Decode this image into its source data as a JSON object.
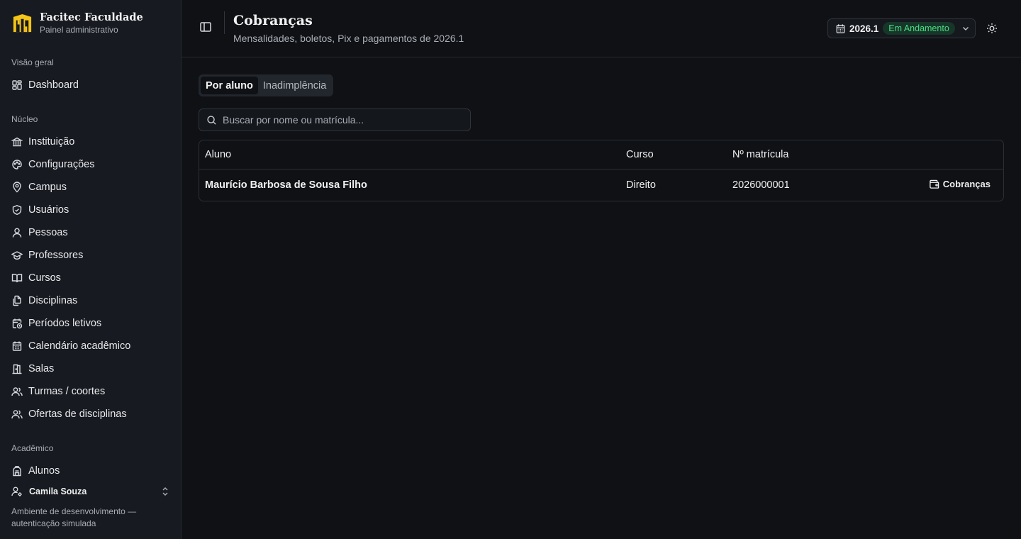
{
  "brand": {
    "name": "Facitec Faculdade",
    "subtitle": "Painel administrativo",
    "logo_color": "#f5c518"
  },
  "sidebar": {
    "groups": [
      {
        "label": "Visão geral",
        "items": [
          {
            "label": "Dashboard",
            "icon": "dashboard-icon"
          }
        ]
      },
      {
        "label": "Núcleo",
        "items": [
          {
            "label": "Instituição",
            "icon": "institution-icon"
          },
          {
            "label": "Configurações",
            "icon": "palette-icon"
          },
          {
            "label": "Campus",
            "icon": "map-pin-icon"
          },
          {
            "label": "Usuários",
            "icon": "shield-icon"
          },
          {
            "label": "Pessoas",
            "icon": "user-icon"
          },
          {
            "label": "Professores",
            "icon": "graduation-cap-icon"
          },
          {
            "label": "Cursos",
            "icon": "book-open-icon"
          },
          {
            "label": "Disciplinas",
            "icon": "files-icon"
          },
          {
            "label": "Períodos letivos",
            "icon": "calendar-clock-icon"
          },
          {
            "label": "Calendário acadêmico",
            "icon": "calendar-icon"
          },
          {
            "label": "Salas",
            "icon": "door-icon"
          },
          {
            "label": "Turmas / coortes",
            "icon": "users-icon"
          },
          {
            "label": "Ofertas de disciplinas",
            "icon": "users-icon"
          }
        ]
      },
      {
        "label": "Acadêmico",
        "items": [
          {
            "label": "Alunos",
            "icon": "backpack-icon"
          }
        ]
      }
    ],
    "user": {
      "name": "Camila Souza",
      "icon": "user-cog-icon"
    },
    "env_note": "Ambiente de desenvolvimento — autenticação simulada"
  },
  "header": {
    "title": "Cobranças",
    "subtitle": "Mensalidades, boletos, Pix e pagamentos de 2026.1",
    "period": {
      "year": "2026.1",
      "status": "Em Andamento",
      "status_color": "#4ade80"
    }
  },
  "tabs": [
    {
      "label": "Por aluno",
      "active": true
    },
    {
      "label": "Inadimplência",
      "active": false
    }
  ],
  "search": {
    "placeholder": "Buscar por nome ou matrícula...",
    "value": ""
  },
  "table": {
    "columns": [
      "Aluno",
      "Curso",
      "Nº matrícula"
    ],
    "rows": [
      {
        "aluno": "Maurício Barbosa de Sousa Filho",
        "curso": "Direito",
        "matricula": "2026000001",
        "action": "Cobranças"
      }
    ]
  }
}
